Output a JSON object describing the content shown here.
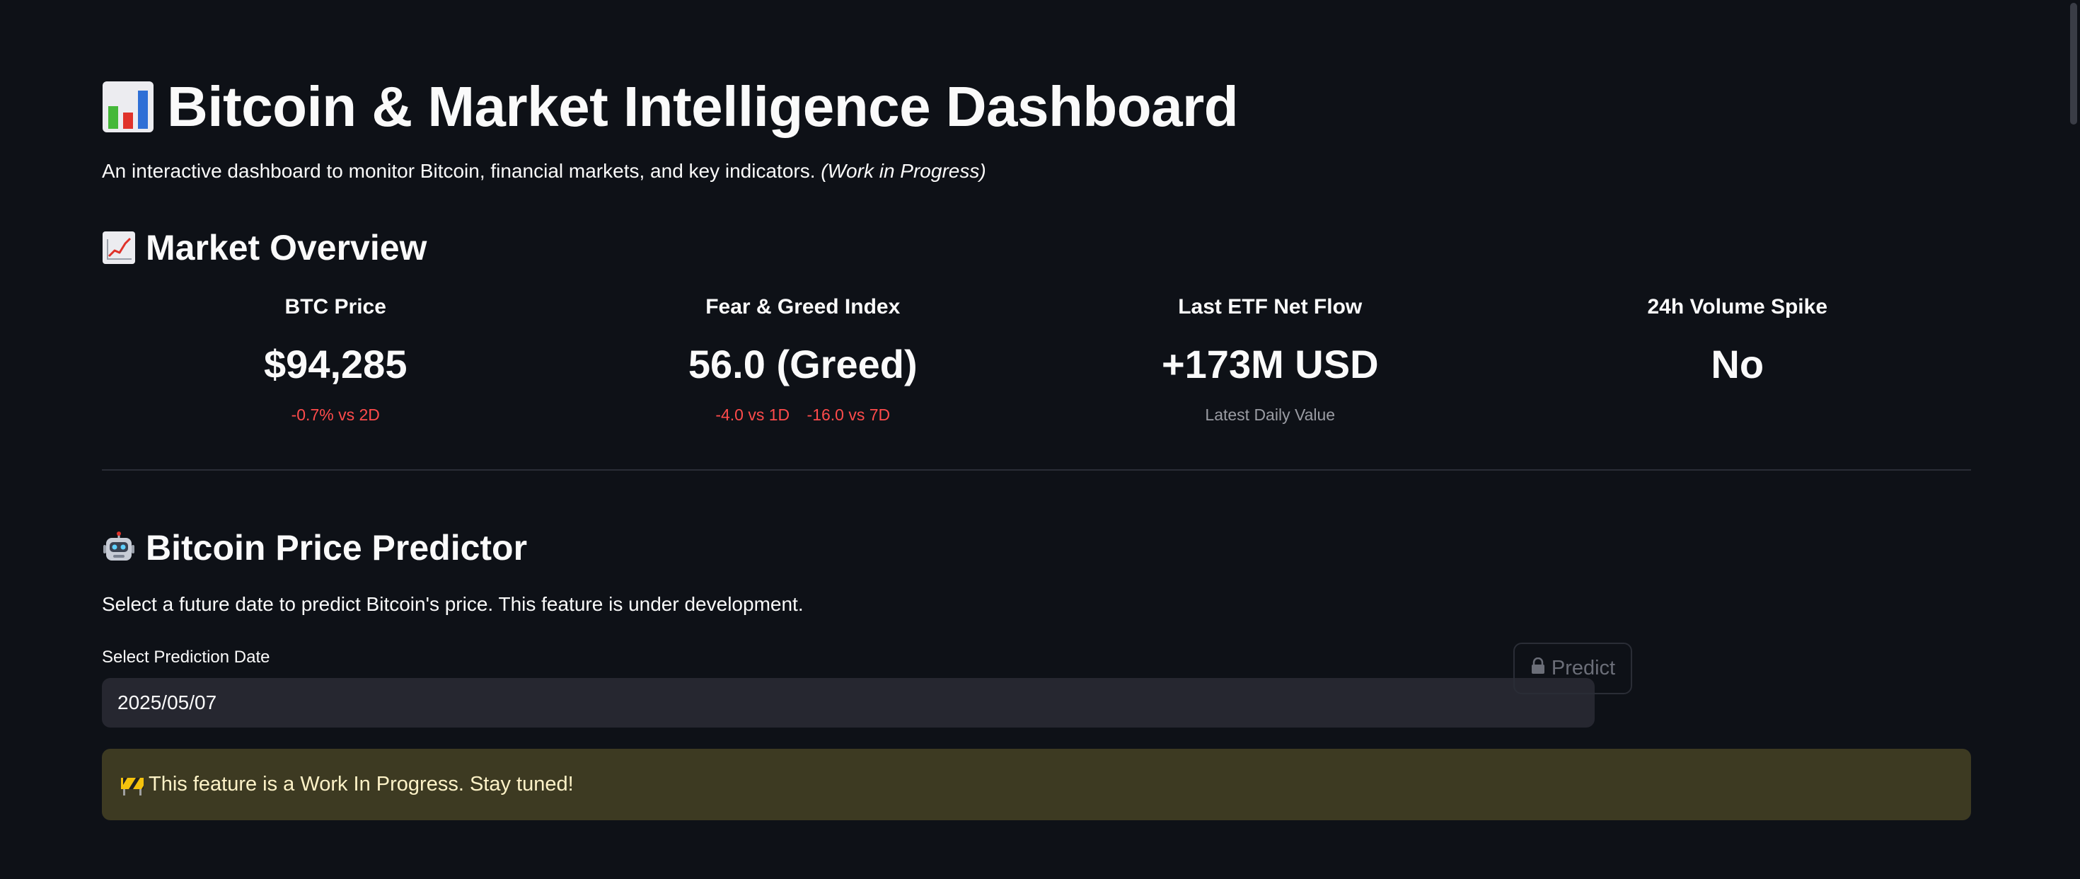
{
  "header": {
    "title_icon": "bar-chart-icon",
    "title": "Bitcoin & Market Intelligence Dashboard",
    "subtitle": "An interactive dashboard to monitor Bitcoin, financial markets, and key indicators.",
    "subtitle_note": "(Work in Progress)"
  },
  "market_overview": {
    "icon": "chart-increasing-icon",
    "heading": "Market Overview",
    "metrics": [
      {
        "label": "BTC Price",
        "value": "$94,285",
        "delta1": "-0.7% vs 2D"
      },
      {
        "label": "Fear & Greed Index",
        "value": "56.0 (Greed)",
        "delta1": "-4.0 vs 1D",
        "delta2": "-16.0 vs 7D"
      },
      {
        "label": "Last ETF Net Flow",
        "value": "+173M USD",
        "note": "Latest Daily Value"
      },
      {
        "label": "24h Volume Spike",
        "value": "No"
      }
    ],
    "colors": {
      "negative": "#ff4b4b",
      "note": "#9a9ca3"
    }
  },
  "predictor": {
    "icon": "robot-icon",
    "heading": "Bitcoin Price Predictor",
    "description": "Select a future date to predict Bitcoin's price. This feature is under development.",
    "date_label": "Select Prediction Date",
    "date_value": "2025/05/07",
    "predict_icon": "lock-icon",
    "predict_label": "Predict",
    "predict_disabled": true,
    "alert_icon": "construction-icon",
    "alert_text": "This feature is a Work In Progress. Stay tuned!"
  },
  "theme": {
    "background": "#0e1117",
    "text": "#fafafa",
    "input_bg": "#262730",
    "alert_bg": "#3d3a22",
    "alert_text": "#fdf2c7"
  }
}
